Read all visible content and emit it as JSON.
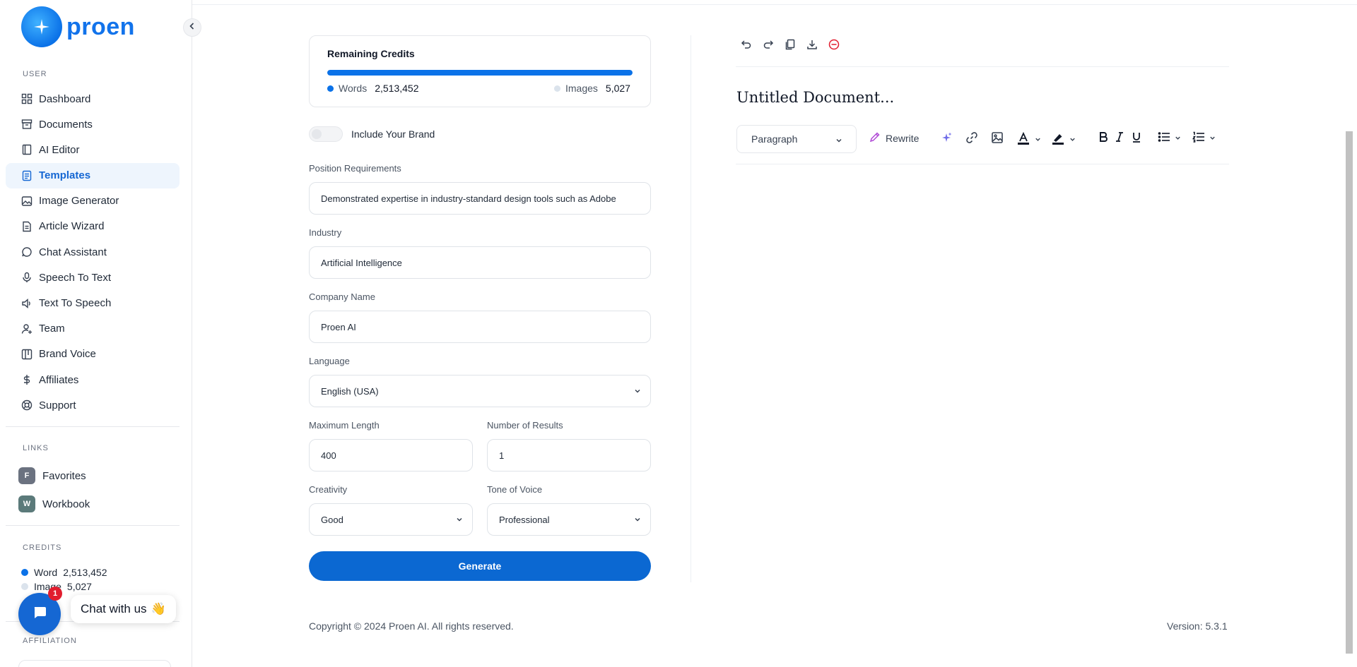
{
  "brand": {
    "name": "proen"
  },
  "sidebar": {
    "user_section": "USER",
    "items": [
      {
        "label": "Dashboard",
        "icon": "grid-icon"
      },
      {
        "label": "Documents",
        "icon": "archive-icon"
      },
      {
        "label": "AI Editor",
        "icon": "book-icon"
      },
      {
        "label": "Templates",
        "icon": "file-text-icon",
        "active": true
      },
      {
        "label": "Image Generator",
        "icon": "image-icon"
      },
      {
        "label": "Article Wizard",
        "icon": "file-plus-icon"
      },
      {
        "label": "Chat Assistant",
        "icon": "message-circle-icon"
      },
      {
        "label": "Speech To Text",
        "icon": "microphone-icon"
      },
      {
        "label": "Text To Speech",
        "icon": "volume-icon"
      },
      {
        "label": "Team",
        "icon": "user-plus-icon"
      },
      {
        "label": "Brand Voice",
        "icon": "layout-icon"
      },
      {
        "label": "Affiliates",
        "icon": "dollar-icon"
      },
      {
        "label": "Support",
        "icon": "lifebuoy-icon"
      }
    ],
    "links_section": "LINKS",
    "links": [
      {
        "label": "Favorites",
        "badge": "F",
        "badge_color": "#6b7280"
      },
      {
        "label": "Workbook",
        "badge": "W",
        "badge_color": "#5b7a7a"
      }
    ],
    "credits_section": "CREDITS",
    "credits": {
      "word_label": "Word",
      "word_value": "2,513,452",
      "image_label": "Image",
      "image_value": "5,027"
    },
    "affiliation_section": "AFFILIATION"
  },
  "chat": {
    "label": "Chat with us",
    "emoji": "👋",
    "unread": "1"
  },
  "form": {
    "credits_card": {
      "title": "Remaining Credits",
      "progress": 1.0,
      "words_label": "Words",
      "words_value": "2,513,452",
      "images_label": "Images",
      "images_value": "5,027"
    },
    "brand_toggle": {
      "label": "Include Your Brand",
      "on": false
    },
    "position_requirements": {
      "label": "Position Requirements",
      "value": "Demonstrated expertise in industry-standard design tools such as Adobe"
    },
    "industry": {
      "label": "Industry",
      "value": "Artificial Intelligence"
    },
    "company_name": {
      "label": "Company Name",
      "value": "Proen AI"
    },
    "language": {
      "label": "Language",
      "value": "English (USA)"
    },
    "max_length": {
      "label": "Maximum Length",
      "value": "400"
    },
    "num_results": {
      "label": "Number of Results",
      "value": "1"
    },
    "creativity": {
      "label": "Creativity",
      "value": "Good"
    },
    "tone": {
      "label": "Tone of Voice",
      "value": "Professional"
    },
    "generate_label": "Generate"
  },
  "editor": {
    "doc_title": "Untitled Document...",
    "format_select": "Paragraph",
    "rewrite_label": "Rewrite"
  },
  "footer": {
    "copyright": "Copyright © 2024 Proen AI. All rights reserved.",
    "version": "Version: 5.3.1"
  },
  "colors": {
    "accent": "#0b68d2",
    "active_bg": "#eef5fd",
    "danger": "#e11d2e"
  }
}
